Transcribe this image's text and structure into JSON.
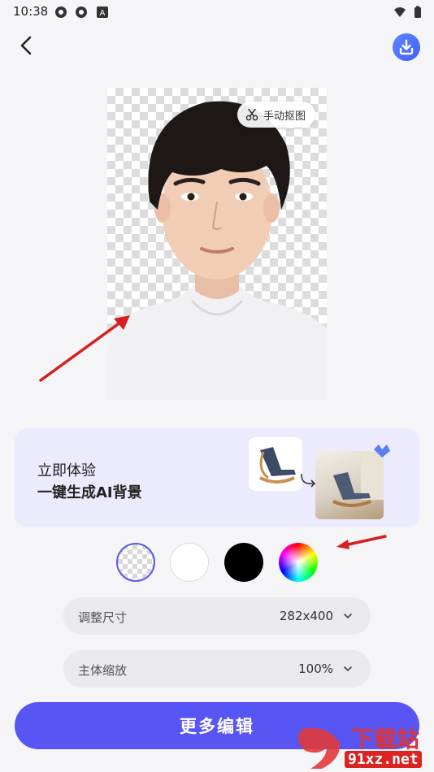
{
  "status_bar": {
    "time": "10:38",
    "icons": [
      "notification-icon",
      "notification-icon",
      "app-a-icon",
      "wifi-icon",
      "battery-icon"
    ]
  },
  "toolbar": {
    "back_icon": "chevron-left-icon",
    "download_icon": "download-icon"
  },
  "photo": {
    "manual_cutout_label": "手动抠图",
    "manual_cutout_icon": "scissors-icon"
  },
  "ai_banner": {
    "line1": "立即体验",
    "line2": "一键生成AI背景"
  },
  "background_colors": [
    {
      "name": "transparent",
      "selected": true
    },
    {
      "name": "white",
      "color": "#ffffff"
    },
    {
      "name": "black",
      "color": "#000000"
    },
    {
      "name": "custom",
      "color": "rainbow"
    }
  ],
  "settings": {
    "size_label": "调整尺寸",
    "size_value": "282x400",
    "scale_label": "主体缩放",
    "scale_value": "100%"
  },
  "actions": {
    "more_edit_label": "更多编辑"
  },
  "watermark": {
    "brand": "下载站",
    "url": "91xz.net"
  },
  "colors": {
    "accent": "#5855f5",
    "banner_bg": "#eceafd",
    "arrow": "#d42020"
  }
}
